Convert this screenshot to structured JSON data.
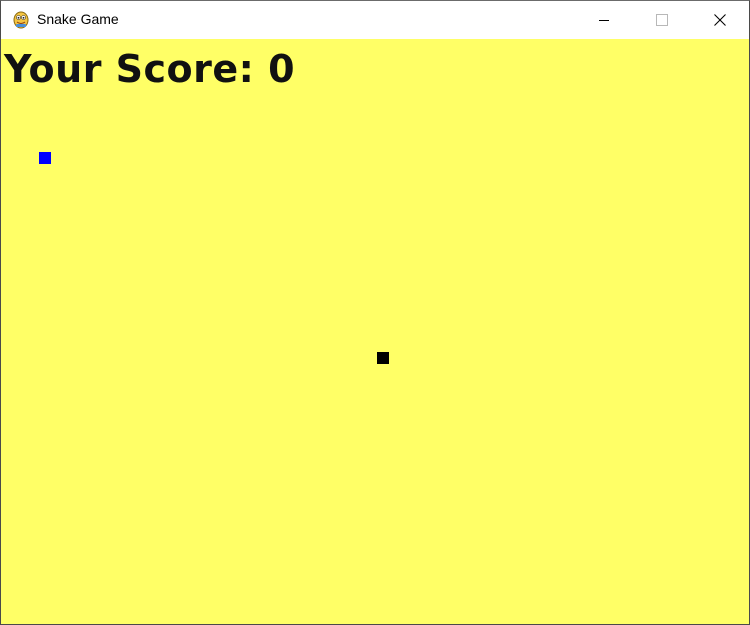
{
  "window": {
    "title": "Snake Game",
    "app_icon": "pygame-snake-logo-icon",
    "controls": {
      "minimize_icon": "minimize-icon",
      "maximize_icon": "maximize-icon",
      "close_icon": "close-icon"
    }
  },
  "game": {
    "score_label": "Your Score: 0",
    "background_color": "#ffff66",
    "food_color": "#0000ff",
    "snake_color": "#000000"
  }
}
